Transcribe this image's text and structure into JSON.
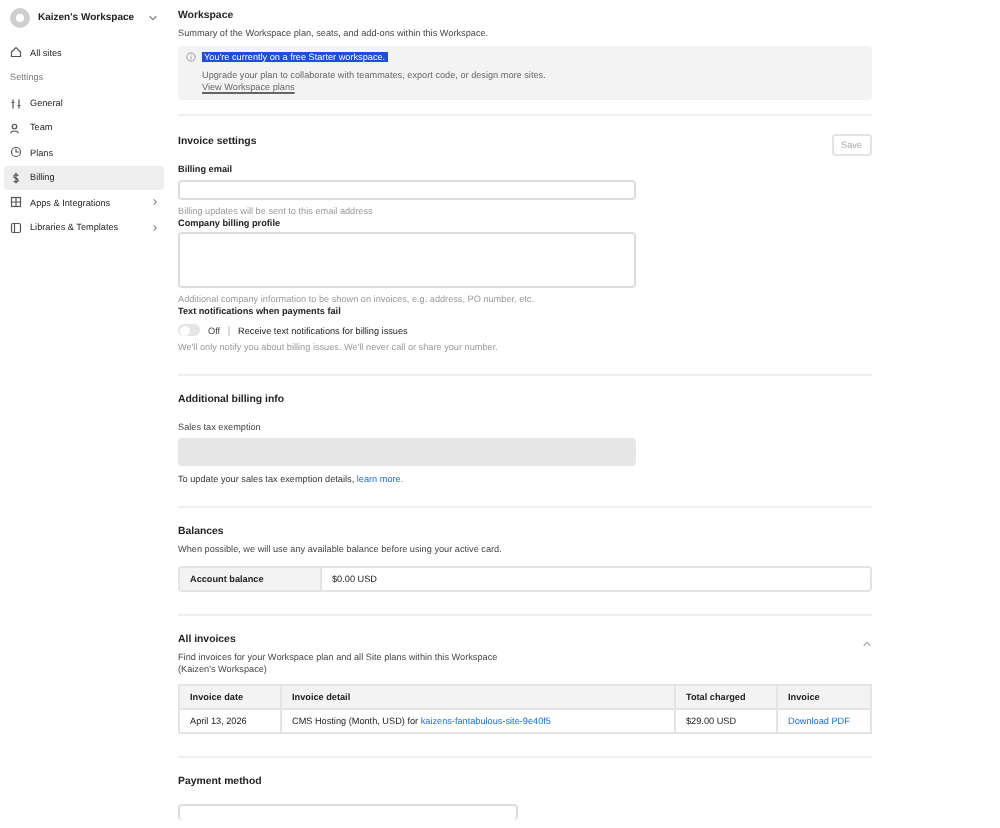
{
  "sidebar": {
    "workspace": "Kaizen's Workspace",
    "items": [
      {
        "label": "All sites",
        "selected": false,
        "has_submenu": false
      },
      {
        "kind": "heading",
        "label": "Settings"
      },
      {
        "label": "General",
        "selected": false,
        "has_submenu": false
      },
      {
        "label": "Team",
        "selected": false,
        "has_submenu": false
      },
      {
        "label": "Plans",
        "selected": false,
        "has_submenu": false
      },
      {
        "label": "Billing",
        "selected": true,
        "has_submenu": false
      },
      {
        "label": "Apps & Integrations",
        "selected": false,
        "has_submenu": true
      },
      {
        "label": "Libraries & Templates",
        "selected": false,
        "has_submenu": true
      }
    ]
  },
  "workspace": {
    "title": "Workspace",
    "subtitle": "Summary of the Workspace plan, seats, and add-ons within this Workspace.",
    "banner": {
      "title": "You're currently on a free Starter workspace.",
      "title_highlighted": true,
      "text": "Upgrade your plan to collaborate with teammates, export code, or design more sites.",
      "link": "View Workspace plans"
    }
  },
  "invoice_settings": {
    "title": "Invoice settings",
    "save_button": "Save",
    "billing_email_label": "Billing email",
    "billing_email_hint": "Billing updates will be sent to this email address",
    "profile_label": "Company billing profile",
    "profile_hint": "Additional company information to be shown on invoices, e.g. address, PO number, etc.",
    "sms_label": "Text notifications when payments fail",
    "sms_on": false,
    "sms_state": "Off",
    "sms_option": "Receive text notifications for billing issues",
    "sms_note": "We'll only notify you about billing issues. We'll never call or share your number."
  },
  "additional_billing": {
    "title": "Additional billing info",
    "field_label": "Sales tax exemption",
    "note": "To update your sales tax exemption details,",
    "note_link": "learn more."
  },
  "balances": {
    "title": "Balances",
    "text": "When possible, we will use any available balance before using your active card.",
    "label": "Account balance",
    "value": "$0.00 USD"
  },
  "invoices": {
    "title": "All invoices",
    "expanded": true,
    "text": "Find invoices for your Workspace plan and all Site plans within this Workspace",
    "text_2": "(Kaizen's Workspace)",
    "columns": [
      "Invoice date",
      "Invoice detail",
      "Total charged",
      "Invoice"
    ],
    "rows": [
      {
        "date": "April 13, 2026",
        "detail": "CMS Hosting (Month, USD) for",
        "site": "kaizens-fantabulous-site-9e40f5",
        "total": "$29.00 USD",
        "link": "Download PDF"
      }
    ]
  },
  "payment": {
    "title": "Payment method"
  }
}
